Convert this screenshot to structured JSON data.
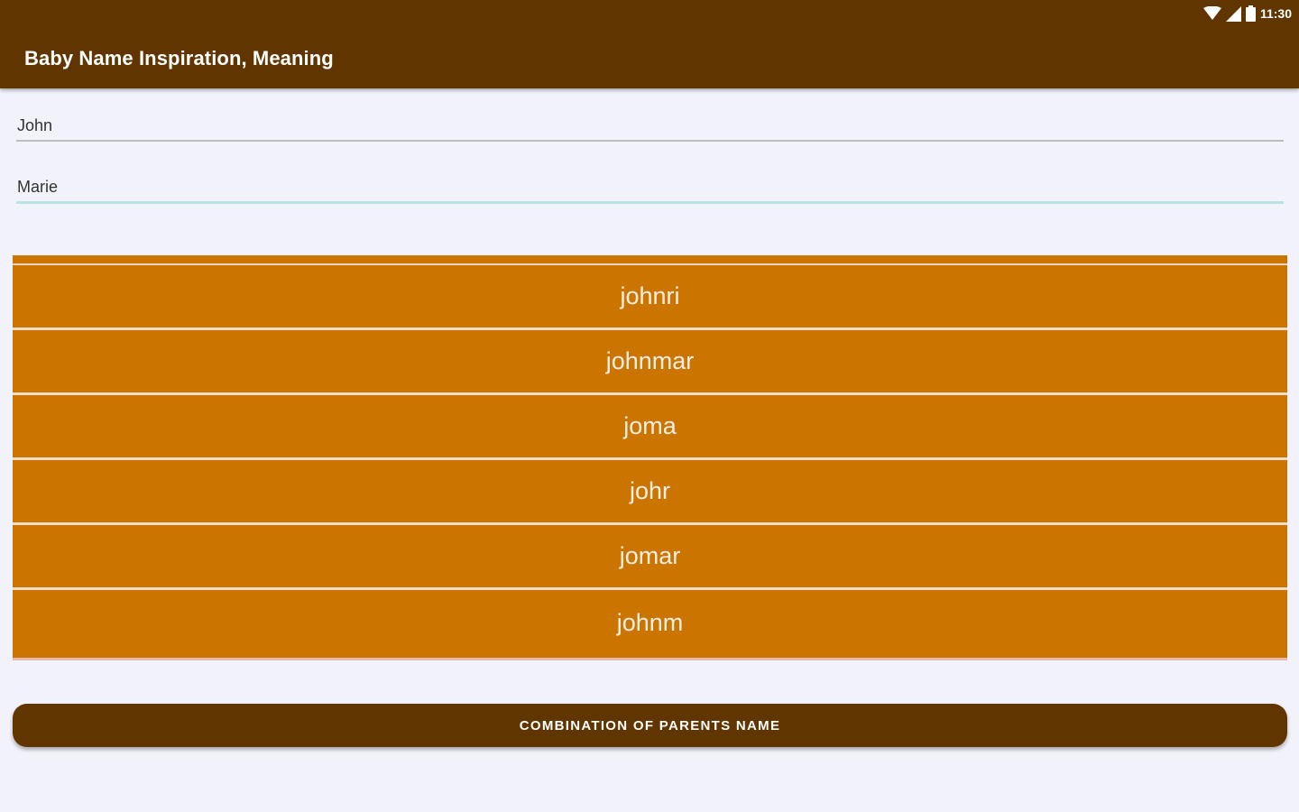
{
  "status_bar": {
    "time": "11:30",
    "icons": [
      "wifi-icon",
      "signal-icon",
      "battery-icon"
    ]
  },
  "app_bar": {
    "title": "Baby Name Inspiration, Meaning"
  },
  "form": {
    "father_name": {
      "value": "John"
    },
    "mother_name": {
      "value": "Marie"
    }
  },
  "results": [
    "johnri",
    "johnmar",
    "joma",
    "johr",
    "jomar",
    "johnm"
  ],
  "actions": {
    "combination_label": "COMBINATION OF PARENTS NAME"
  },
  "colors": {
    "primary_dark": "#603500",
    "list_background": "#cc7400",
    "page_background": "#f2f3fa",
    "focus_underline": "#b6e4e4"
  }
}
